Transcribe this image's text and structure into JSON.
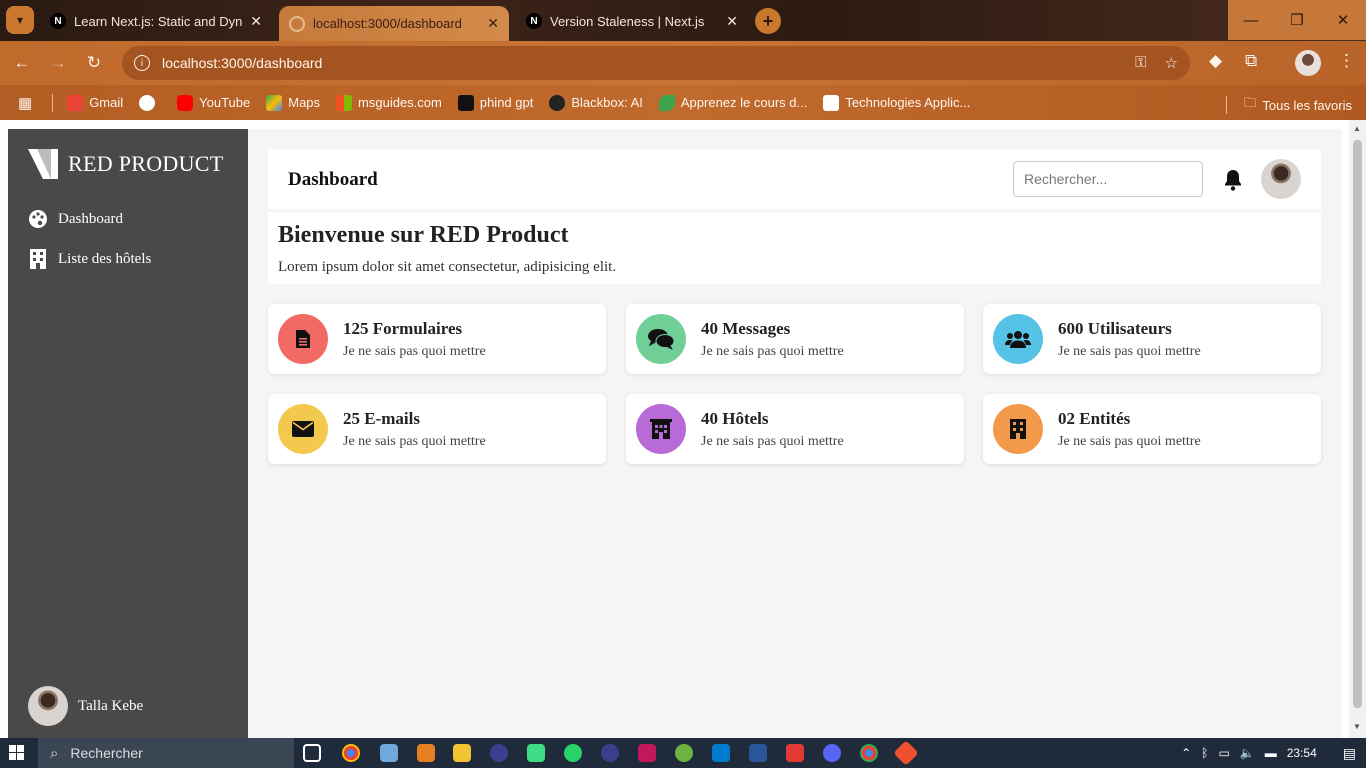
{
  "browser": {
    "tabs": [
      {
        "favicon": "N",
        "title": "Learn Next.js: Static and Dynam",
        "close": "✕"
      },
      {
        "favicon": "",
        "title": "localhost:3000/dashboard",
        "close": "✕"
      },
      {
        "favicon": "N",
        "title": "Version Staleness | Next.js",
        "close": "✕"
      }
    ],
    "new_tab": "+",
    "url": "localhost:3000/dashboard",
    "bookmarks": [
      {
        "label": "Gmail",
        "icon": "gmail-icon",
        "color": "#ea4335"
      },
      {
        "label": "",
        "icon": "globe-icon",
        "color": "#ffffff"
      },
      {
        "label": "YouTube",
        "icon": "youtube-icon",
        "color": "#ff0000"
      },
      {
        "label": "Maps",
        "icon": "maps-icon",
        "color": "#34a853"
      },
      {
        "label": "msguides.com",
        "icon": "msguides-icon",
        "color": "#2d6cdf"
      },
      {
        "label": "phind gpt",
        "icon": "phind-icon",
        "color": "#111111"
      },
      {
        "label": "Blackbox: AI",
        "icon": "blackbox-icon",
        "color": "#222222"
      },
      {
        "label": "Apprenez le cours d...",
        "icon": "leaf-icon",
        "color": "#3fa34d"
      },
      {
        "label": "Technologies Applic...",
        "icon": "openai-icon",
        "color": "#ffffff"
      }
    ],
    "all_bookmarks": "Tous les favoris"
  },
  "app": {
    "brand": "RED PRODUCT",
    "sidebar": {
      "items": [
        {
          "label": "Dashboard",
          "icon": "palette-icon"
        },
        {
          "label": "Liste des hôtels",
          "icon": "building-icon"
        }
      ],
      "user_name": "Talla Kebe"
    },
    "topbar": {
      "title": "Dashboard",
      "search_placeholder": "Rechercher..."
    },
    "welcome": {
      "heading": "Bienvenue sur RED Product",
      "text": "Lorem ipsum dolor sit amet consectetur, adipisicing elit."
    },
    "cards": [
      {
        "title": "125 Formulaires",
        "subtitle": "Je ne sais pas quoi mettre",
        "icon": "file-icon",
        "color": "#f36a64"
      },
      {
        "title": "40 Messages",
        "subtitle": "Je ne sais pas quoi mettre",
        "icon": "comments-icon",
        "color": "#6fcf97"
      },
      {
        "title": "600 Utilisateurs",
        "subtitle": "Je ne sais pas quoi mettre",
        "icon": "users-icon",
        "color": "#56c2e6"
      },
      {
        "title": "25 E-mails",
        "subtitle": "Je ne sais pas quoi mettre",
        "icon": "envelope-icon",
        "color": "#f2c94c"
      },
      {
        "title": "40 Hôtels",
        "subtitle": "Je ne sais pas quoi mettre",
        "icon": "hotel-icon",
        "color": "#b86bd6"
      },
      {
        "title": "02 Entités",
        "subtitle": "Je ne sais pas quoi mettre",
        "icon": "building-icon",
        "color": "#f2994a"
      }
    ]
  },
  "taskbar": {
    "search_label": "Rechercher",
    "time": "23:54"
  }
}
